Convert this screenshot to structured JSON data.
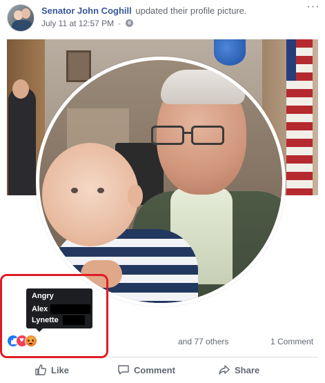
{
  "post": {
    "author": "Senator John Coghill",
    "action": "updated their profile picture.",
    "timestamp": "July 11 at 12:57 PM",
    "separator": "·",
    "privacy_icon": "globe-icon",
    "more_label": "···"
  },
  "tooltip": {
    "title": "Angry",
    "names": [
      "Alex",
      "Lynette"
    ]
  },
  "reactions": {
    "icons": [
      "like-react-icon",
      "love-react-icon",
      "angry-react-icon"
    ],
    "others_text": "and 77 others",
    "comments_text": "1 Comment"
  },
  "actions": {
    "like_label": "Like",
    "comment_label": "Comment",
    "share_label": "Share"
  },
  "colors": {
    "link_blue": "#365899",
    "muted_text": "#606770",
    "like_blue": "#2078f4",
    "love_red": "#f33e58",
    "angry_orange": "#f28b32",
    "annotation_red": "#e01b24"
  }
}
